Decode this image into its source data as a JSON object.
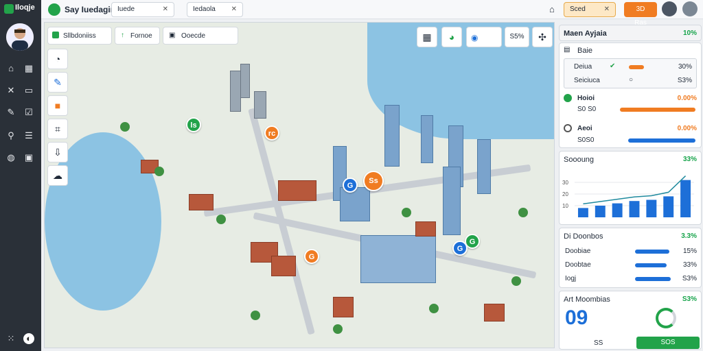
{
  "app": {
    "name": "Iloqje"
  },
  "topbar": {
    "title": "Say Iuedagin",
    "tab1": "Iuede",
    "tab2": "Iedaola",
    "search": "Sced",
    "action": "3D Ras"
  },
  "rail": {
    "icons": [
      "home-icon",
      "grid-icon",
      "tools-icon",
      "folder-icon",
      "edit-icon",
      "check-icon",
      "search-icon",
      "list-icon",
      "globe-icon",
      "crop-icon",
      "apps-icon",
      "moon-icon"
    ]
  },
  "map": {
    "tab_a": "Sllbdoniiss",
    "tab_b": "Fornoe",
    "tab_c": "Ooecde",
    "zoom": "S5%",
    "toolbar": [
      "grid-icon",
      "chart-icon",
      "layers-icon",
      "zoom",
      "compass-icon"
    ],
    "side_tools": [
      "dashboard-icon",
      "brush-icon",
      "box-icon",
      "crop-icon",
      "download-icon",
      "cloud-icon"
    ],
    "pins": [
      {
        "label": "ls"
      },
      {
        "label": "rc"
      },
      {
        "label": "Ss"
      },
      {
        "label": "G"
      },
      {
        "label": "G"
      },
      {
        "label": "G"
      },
      {
        "label": "G"
      }
    ]
  },
  "panel": {
    "header": {
      "title": "Maen Ayjaia",
      "value": "10%"
    },
    "card1": {
      "title": "Baie",
      "rows": [
        {
          "label": "Deiua",
          "value": "30%"
        },
        {
          "label": "Seiciuca",
          "value": "S3%"
        }
      ],
      "sub1": {
        "label": "Hoioi",
        "sub": "S0 S0",
        "value": "0.00%"
      },
      "sub2": {
        "label": "Aeoi",
        "sub": "S0S0",
        "value": "0.00%"
      }
    },
    "chart": {
      "title": "Soooung",
      "value": "33%"
    },
    "list": {
      "title": "Di Doonbos",
      "value": "3.3%",
      "rows": [
        {
          "label": "Doobiae",
          "value": "15%"
        },
        {
          "label": "Doobtae",
          "value": "33%"
        },
        {
          "label": "Iogj",
          "value": "S3%"
        }
      ]
    },
    "stats": {
      "title": "Art Moombias",
      "value": "S3%",
      "big": "09",
      "foot": "SS",
      "button": "SOS"
    }
  },
  "chart_data": {
    "type": "bar",
    "categories": [
      "",
      "",
      "",
      "",
      "",
      "",
      ""
    ],
    "values": [
      8,
      10,
      12,
      14,
      15,
      18,
      32
    ],
    "title": "Soooung",
    "ylim": [
      0,
      40
    ],
    "ticks": [
      "30",
      "20",
      "10"
    ]
  },
  "colors": {
    "accent": "#1d6fd8",
    "success": "#22a34a",
    "warning": "#f07c22",
    "rail": "#2a3038"
  }
}
